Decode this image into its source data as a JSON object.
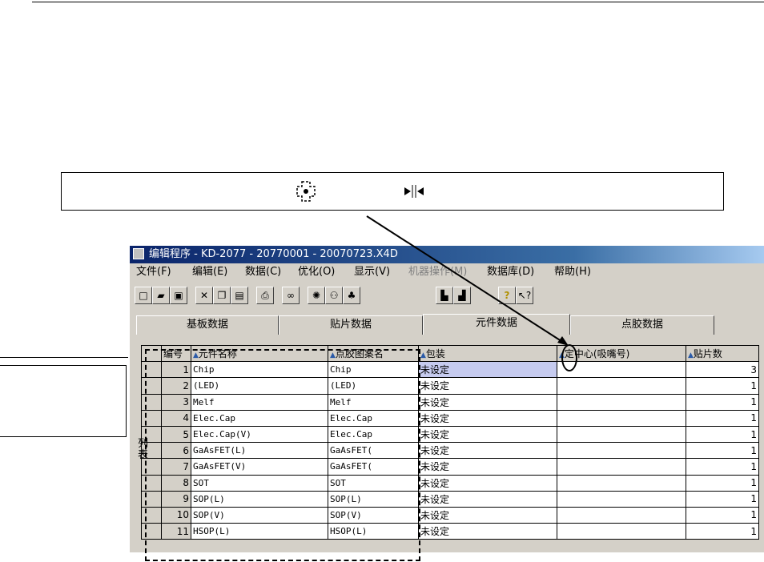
{
  "callout": {
    "move_icon": "center-position-icon",
    "resize_icon": "split-arrows-icon"
  },
  "window": {
    "title": "编辑程序 - KD-2077 - 20770001 - 20070723.X4D",
    "menu": [
      "文件(F)",
      "编辑(E)",
      "数据(C)",
      "优化(O)",
      "显示(V)",
      "机器操作(M)",
      "数据库(D)",
      "帮助(H)"
    ],
    "toolbar_icons": [
      "new-icon",
      "open-icon",
      "save-icon",
      "cut-icon",
      "copy-icon",
      "paste-icon",
      "print-icon",
      "find-icon",
      "bulb-icon",
      "nozzle-icon",
      "components-icon",
      "machine-left-icon",
      "machine-right-icon",
      "help-icon",
      "context-help-icon"
    ],
    "tabs": [
      "基板数据",
      "贴片数据",
      "元件数据",
      "点胶数据"
    ],
    "active_tab": 2
  },
  "table": {
    "headers": [
      "编号",
      "元件名称",
      "点胶图案名",
      "包装",
      "定中心(吸嘴号)",
      "贴片数"
    ],
    "rows": [
      {
        "no": "1",
        "name": "Chip",
        "pattern": "Chip",
        "pkg": "未设定",
        "center": "",
        "count": "3"
      },
      {
        "no": "2",
        "name": "(LED)",
        "pattern": "(LED)",
        "pkg": "未设定",
        "center": "",
        "count": "1"
      },
      {
        "no": "3",
        "name": "Melf",
        "pattern": "Melf",
        "pkg": "未设定",
        "center": "",
        "count": "1"
      },
      {
        "no": "4",
        "name": "Elec.Cap",
        "pattern": "Elec.Cap",
        "pkg": "未设定",
        "center": "",
        "count": "1"
      },
      {
        "no": "5",
        "name": "Elec.Cap(V)",
        "pattern": "Elec.Cap",
        "pkg": "未设定",
        "center": "",
        "count": "1"
      },
      {
        "no": "6",
        "name": "GaAsFET(L)",
        "pattern": "GaAsFET(",
        "pkg": "未设定",
        "center": "",
        "count": "1"
      },
      {
        "no": "7",
        "name": "GaAsFET(V)",
        "pattern": "GaAsFET(",
        "pkg": "未设定",
        "center": "",
        "count": "1"
      },
      {
        "no": "8",
        "name": "SOT",
        "pattern": "SOT",
        "pkg": "未设定",
        "center": "",
        "count": "1"
      },
      {
        "no": "9",
        "name": "SOP(L)",
        "pattern": "SOP(L)",
        "pkg": "未设定",
        "center": "",
        "count": "1"
      },
      {
        "no": "10",
        "name": "SOP(V)",
        "pattern": "SOP(V)",
        "pkg": "未设定",
        "center": "",
        "count": "1"
      },
      {
        "no": "11",
        "name": "HSOP(L)",
        "pattern": "HSOP(L)",
        "pkg": "未设定",
        "center": "",
        "count": "1"
      }
    ]
  },
  "vertical_label": "列表"
}
